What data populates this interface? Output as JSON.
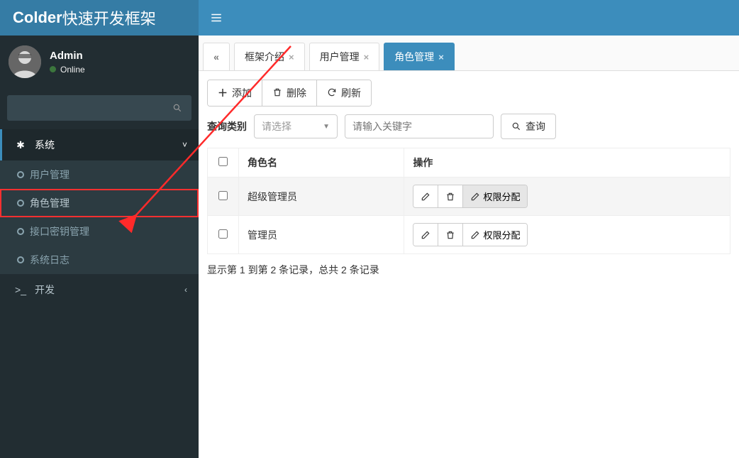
{
  "brand": {
    "bold": "Colder",
    "rest": "快速开发框架"
  },
  "user": {
    "name": "Admin",
    "status": "Online"
  },
  "sidebar": {
    "system": {
      "label": "系统",
      "expanded": true,
      "items": [
        {
          "label": "用户管理"
        },
        {
          "label": "角色管理"
        },
        {
          "label": "接口密钥管理"
        },
        {
          "label": "系统日志"
        }
      ]
    },
    "dev": {
      "label": "开发"
    }
  },
  "tabs": [
    {
      "label": "框架介绍",
      "closable": true
    },
    {
      "label": "用户管理",
      "closable": true
    },
    {
      "label": "角色管理",
      "closable": true,
      "active": true
    }
  ],
  "toolbar": {
    "add": "添加",
    "delete": "删除",
    "refresh": "刷新"
  },
  "filter": {
    "label": "查询类别",
    "select_placeholder": "请选择",
    "input_placeholder": "请输入关键字",
    "search": "查询"
  },
  "table": {
    "columns": {
      "name": "角色名",
      "ops": "操作"
    },
    "rows": [
      {
        "name": "超级管理员",
        "checked": false,
        "selected": true,
        "perm_highlight": true
      },
      {
        "name": "管理员",
        "checked": false,
        "selected": false,
        "perm_highlight": false
      }
    ],
    "ops": {
      "edit": "编辑",
      "delete": "删除",
      "perm": "权限分配"
    }
  },
  "pager": {
    "text": "显示第 1 到第 2 条记录，总共 2 条记录"
  }
}
